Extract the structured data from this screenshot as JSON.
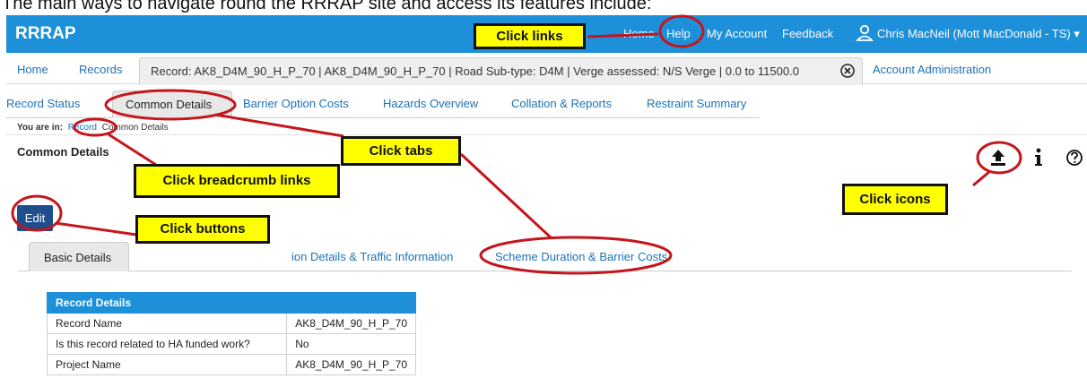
{
  "intro_text": "The main ways to navigate round the RRRAP site and access its features include:",
  "app": {
    "brand": "RRRAP",
    "top_nav": {
      "home": "Home",
      "help": "Help",
      "my_account": "My Account",
      "feedback": "Feedback"
    },
    "user_name": "Chris MacNeil (Mott MacDonald - TS) ▾"
  },
  "nav": {
    "home": "Home",
    "records": "Records",
    "record_tab": "Record: AK8_D4M_90_H_P_70 | AK8_D4M_90_H_P_70 | Road Sub-type: D4M | Verge assessed: N/S Verge | 0.0 to 11500.0",
    "account_admin": "Account Administration"
  },
  "subtabs": {
    "record_status": "Record Status",
    "common_details": "Common Details",
    "barrier_option_costs": "Barrier Option Costs",
    "hazards_overview": "Hazards Overview",
    "collation_reports": "Collation & Reports",
    "restraint_summary": "Restraint Summary"
  },
  "breadcrumb": {
    "prefix": "You are in:",
    "record": "Record",
    "current": "Common Details"
  },
  "section_title": "Common Details",
  "edit_label": "Edit",
  "content_tabs": {
    "basic_details": "Basic Details",
    "location_traffic": "ion Details & Traffic Information",
    "scheme_duration": "Scheme Duration & Barrier Costs"
  },
  "record_details": {
    "header": "Record Details",
    "rows": [
      {
        "label": "Record Name",
        "value": "AK8_D4M_90_H_P_70"
      },
      {
        "label": "Is this record related to HA funded work?",
        "value": "No"
      },
      {
        "label": "Project Name",
        "value": "AK8_D4M_90_H_P_70"
      }
    ]
  },
  "callouts": {
    "links": "Click links",
    "tabs": "Click tabs",
    "breadcrumb": "Click breadcrumb links",
    "buttons": "Click buttons",
    "icons": "Click icons"
  },
  "colors": {
    "appbar": "#1e8fd9",
    "link": "#1a73b8",
    "edit_button": "#1f4e8c",
    "callout": "#ffff00",
    "annotation": "#c4161c"
  },
  "icons": [
    "user-icon",
    "close-icon",
    "upload-icon",
    "info-icon",
    "help-icon"
  ]
}
